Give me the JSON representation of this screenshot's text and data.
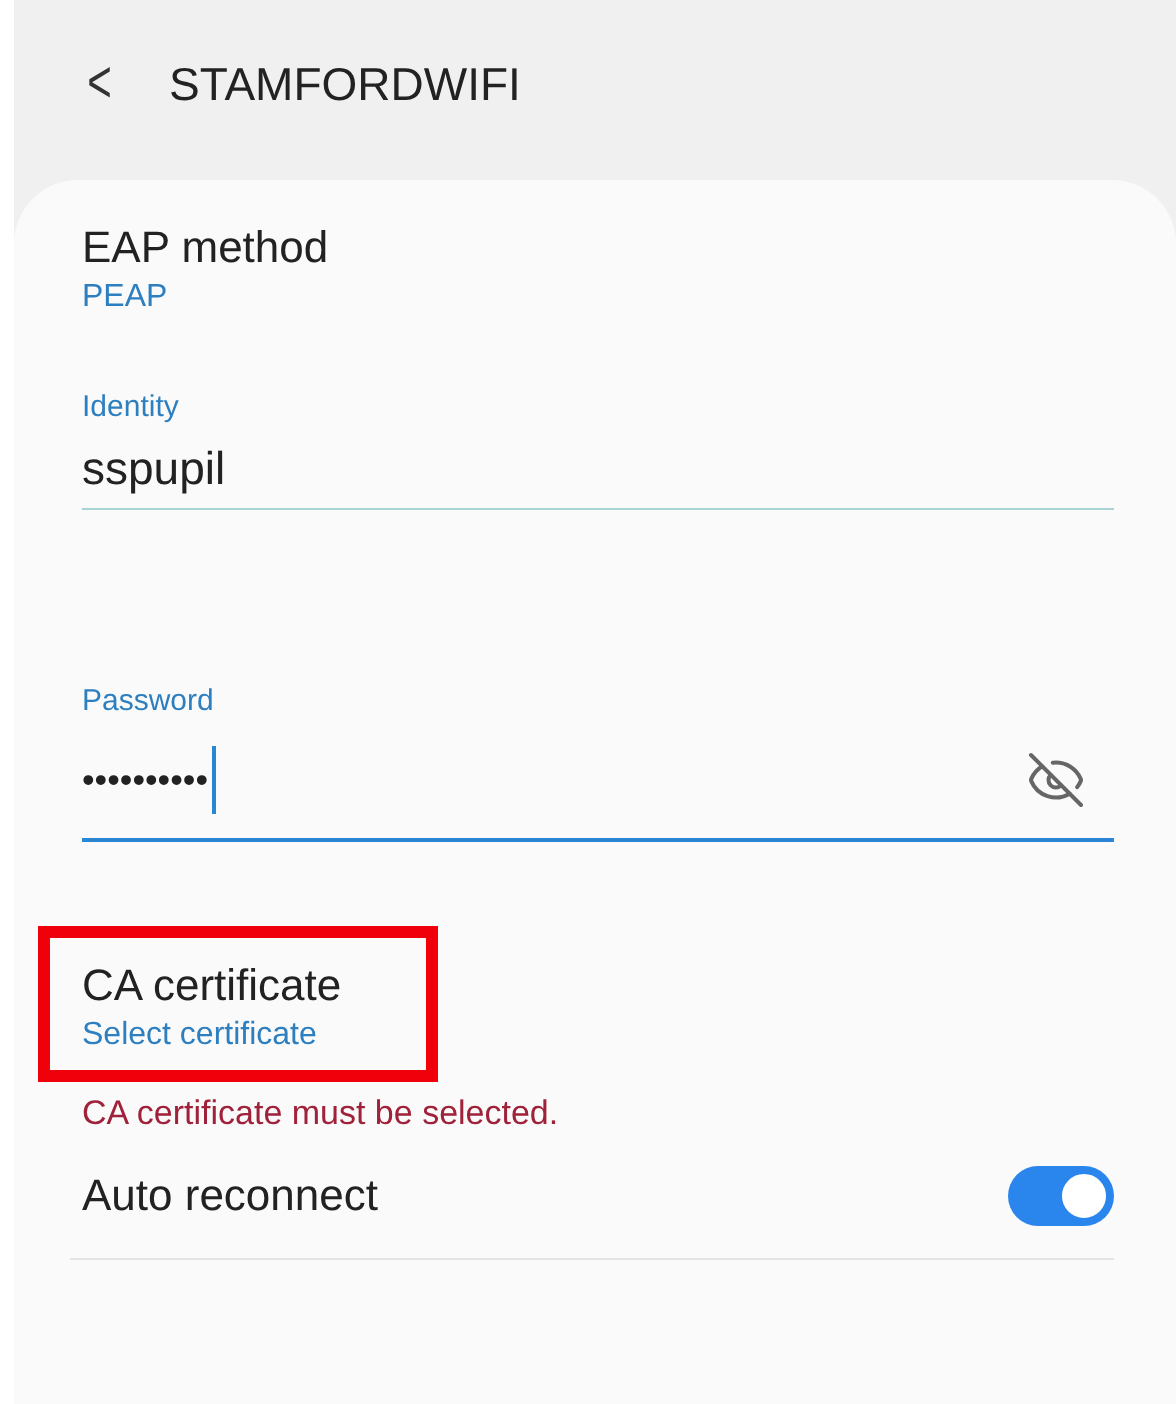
{
  "header": {
    "back_glyph": "<",
    "title": "STAMFORDWIFI"
  },
  "eap_method": {
    "label": "EAP method",
    "value": "PEAP"
  },
  "identity": {
    "label": "Identity",
    "value": "sspupil",
    "focused": false
  },
  "password": {
    "label": "Password",
    "value": "••••••••••",
    "focused": true,
    "visible": false
  },
  "ca_certificate": {
    "label": "CA certificate",
    "value": "Select certificate",
    "highlighted": true,
    "error": "CA certificate must be selected."
  },
  "auto_reconnect": {
    "label": "Auto reconnect",
    "on": true
  }
}
